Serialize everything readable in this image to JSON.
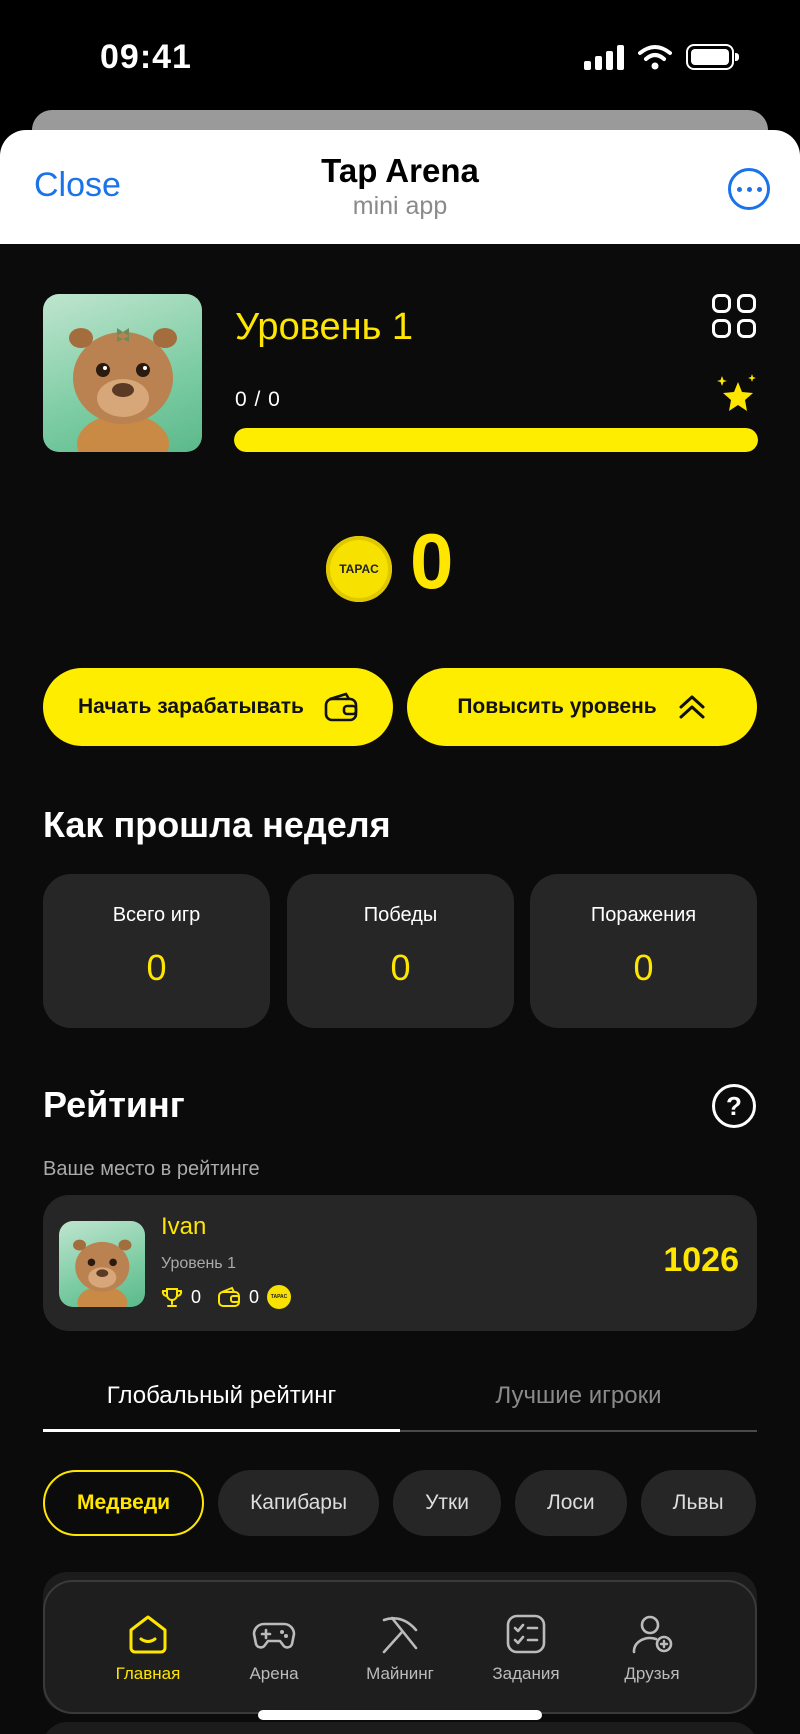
{
  "status_bar": {
    "time": "09:41"
  },
  "header": {
    "close_label": "Close",
    "title": "Tap Arena",
    "subtitle": "mini app"
  },
  "profile": {
    "level_label": "Уровень 1",
    "progress_text": "0 / 0",
    "progress_fraction": 1.0
  },
  "balance": {
    "coin_label": "TAPAC",
    "value": "0"
  },
  "actions": {
    "earn_label": "Начать зарабатывать",
    "level_up_label": "Повысить уровень"
  },
  "week": {
    "title": "Как прошла неделя",
    "stats": [
      {
        "label": "Всего игр",
        "value": "0"
      },
      {
        "label": "Победы",
        "value": "0"
      },
      {
        "label": "Поражения",
        "value": "0"
      }
    ]
  },
  "rating": {
    "title": "Рейтинг",
    "help": "?",
    "your_place_label": "Ваше место в рейтинге",
    "player": {
      "name": "Ivan",
      "level": "Уровень 1",
      "wins": "0",
      "earned": "0",
      "score": "1026"
    },
    "tabs": [
      "Глобальный рейтинг",
      "Лучшие игроки"
    ],
    "chips": [
      "Медведи",
      "Капибары",
      "Утки",
      "Лоси",
      "Львы"
    ]
  },
  "nav": {
    "items": [
      {
        "label": "Главная",
        "icon": "home-icon"
      },
      {
        "label": "Арена",
        "icon": "gamepad-icon"
      },
      {
        "label": "Майнинг",
        "icon": "pickaxe-icon"
      },
      {
        "label": "Задания",
        "icon": "tasks-icon"
      },
      {
        "label": "Друзья",
        "icon": "add-friend-icon"
      }
    ]
  },
  "colors": {
    "accent": "#ffed00",
    "link": "#1a73e8",
    "card": "#262626",
    "background": "#0b0b0b"
  }
}
